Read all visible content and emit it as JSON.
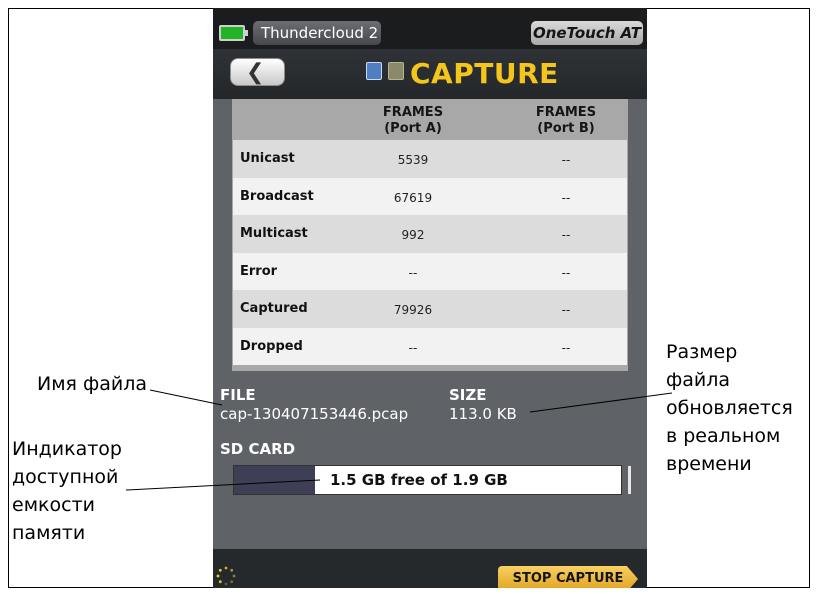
{
  "status_bar": {
    "network_name": "Thundercloud 2",
    "device_name": "OneTouch AT"
  },
  "title_bar": {
    "title": "CAPTURE",
    "back_icon": "back-arrow-icon",
    "icons": [
      "capture-icon",
      "module-icon"
    ]
  },
  "table": {
    "columns": [
      "FRAMES\n(Port A)",
      "FRAMES\n(Port B)"
    ],
    "rows": [
      {
        "label": "Unicast",
        "port_a": "5539",
        "port_b": "--"
      },
      {
        "label": "Broadcast",
        "port_a": "67619",
        "port_b": "--"
      },
      {
        "label": "Multicast",
        "port_a": "992",
        "port_b": "--"
      },
      {
        "label": "Error",
        "port_a": "--",
        "port_b": "--"
      },
      {
        "label": "Captured",
        "port_a": "79926",
        "port_b": "--"
      },
      {
        "label": "Dropped",
        "port_a": "--",
        "port_b": "--"
      }
    ]
  },
  "file": {
    "file_label": "FILE",
    "file_name": "cap-130407153446.pcap",
    "size_label": "SIZE",
    "size_value": "113.0 KB"
  },
  "sd_card": {
    "label": "SD CARD",
    "text": "1.5 GB free of 1.9 GB",
    "used_fraction": 0.21
  },
  "bottom_bar": {
    "spinner_icon": "busy-spinner-icon",
    "stop_button_label": "STOP CAPTURE"
  },
  "annotations": {
    "file_name_callout": "Имя файла",
    "storage_callout": "Индикатор\nдоступной\nемкости\nпамяти",
    "size_callout": "Размер\nфайла\nобновляется\nв реальном\nвремени"
  },
  "colors": {
    "accent": "#f4c51a",
    "battery": "#22b326",
    "stop_button": "#f2c149"
  }
}
